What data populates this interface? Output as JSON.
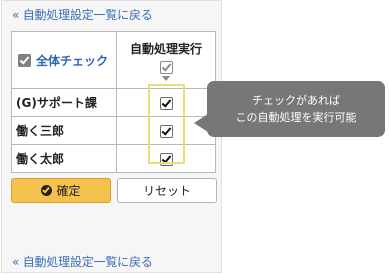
{
  "nav": {
    "back_link_top": "« 自動処理設定一覧に戻る",
    "back_link_bottom": "« 自動処理設定一覧に戻る"
  },
  "table": {
    "select_all_label": "全体チェック",
    "column_header": "自動処理実行",
    "rows": [
      {
        "name": "(G)サポート課",
        "checked": true
      },
      {
        "name": "働く三郎",
        "checked": true
      },
      {
        "name": "働く太郎",
        "checked": true
      }
    ]
  },
  "buttons": {
    "confirm_label": "確定",
    "reset_label": "リセット"
  },
  "callout": {
    "line1": "チェックがあれば",
    "line2": "この自動処理を実行可能"
  },
  "colors": {
    "link": "#3a6fb5",
    "confirm_button": "#f4c24d",
    "callout_bg": "#777777",
    "highlight_border": "#e9df7a"
  }
}
